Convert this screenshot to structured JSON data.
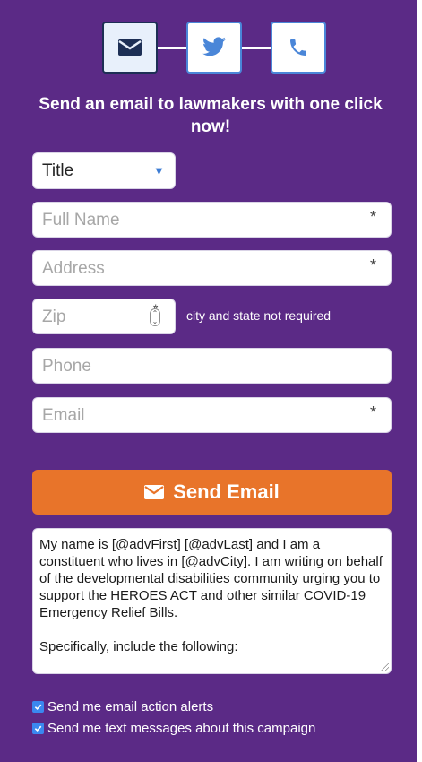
{
  "colors": {
    "background": "#5b2a86",
    "accent_orange": "#e8742a",
    "tab_border": "#4a86d8",
    "checkbox_blue": "#3a88f0"
  },
  "tabs": [
    {
      "icon": "envelope-icon",
      "active": true
    },
    {
      "icon": "twitter-icon",
      "active": false
    },
    {
      "icon": "phone-icon",
      "active": false
    }
  ],
  "headline": "Send an email to lawmakers with one click now!",
  "form": {
    "title_select": {
      "value": "Title"
    },
    "full_name": {
      "placeholder": "Full Name",
      "required_mark": "*"
    },
    "address": {
      "placeholder": "Address",
      "required_mark": "*"
    },
    "zip": {
      "placeholder": "Zip",
      "required_mark": "*",
      "note": "city and state not required"
    },
    "phone": {
      "placeholder": "Phone"
    },
    "email": {
      "placeholder": "Email",
      "required_mark": "*"
    }
  },
  "send_button": {
    "label": "Send Email",
    "icon": "envelope-icon"
  },
  "message_text": "My name is [@advFirst] [@advLast] and I am a constituent who lives in [@advCity]. I am writing on behalf of the developmental disabilities community urging you to support the HEROES ACT and other similar COVID-19 Emergency Relief Bills.\n\nSpecifically, include the following:\n\n  - Funding for a HCBS Medicaid support",
  "checkboxes": [
    {
      "label": "Send me email action alerts",
      "checked": true
    },
    {
      "label": "Send me text messages about this campaign",
      "checked": true
    }
  ]
}
